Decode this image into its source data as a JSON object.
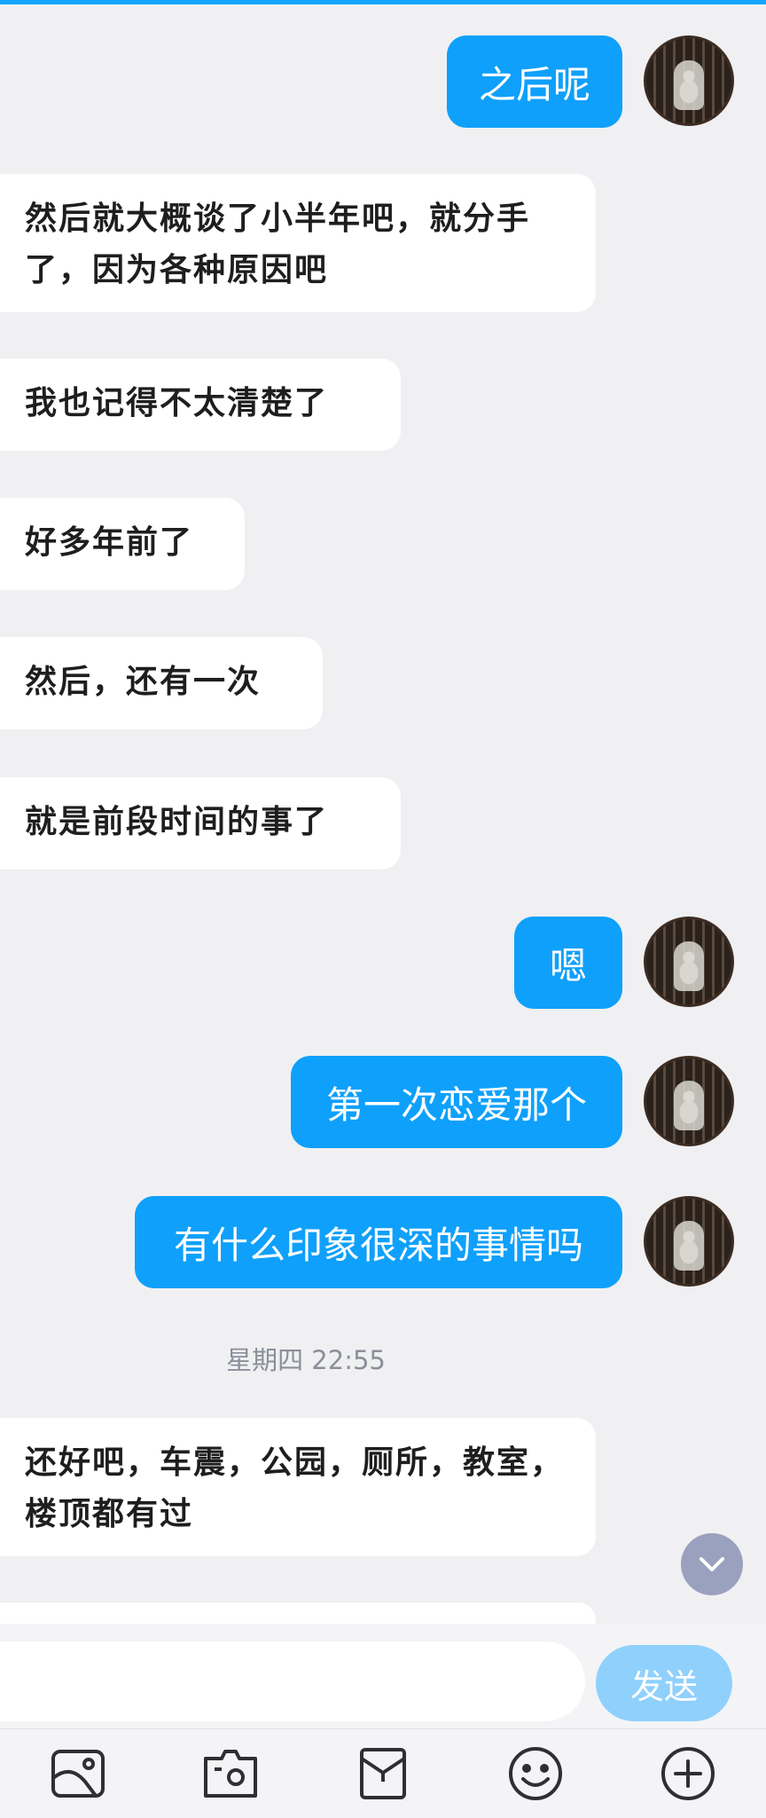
{
  "messages": [
    {
      "side": "right",
      "text": "之后呢"
    },
    {
      "side": "left",
      "text": "然后就大概谈了小半年吧，就分手了，因为各种原因吧"
    },
    {
      "side": "left",
      "text": "我也记得不太清楚了"
    },
    {
      "side": "left",
      "text": "好多年前了"
    },
    {
      "side": "left",
      "text": "然后，还有一次"
    },
    {
      "side": "left",
      "text": "就是前段时间的事了"
    },
    {
      "side": "right",
      "text": "嗯"
    },
    {
      "side": "right",
      "text": "第一次恋爱那个"
    },
    {
      "side": "right",
      "text": "有什么印象很深的事情吗"
    },
    {
      "side": "left",
      "text": "还好吧，车震，公园，厕所，教室，楼顶都有过"
    }
  ],
  "timestamp": "星期四 22:55",
  "input": {
    "placeholder": ""
  },
  "send_label": "发送",
  "toolbar_icons": [
    "image-icon",
    "camera-icon",
    "folder-icon",
    "emoji-icon",
    "plus-icon"
  ],
  "colors": {
    "accent": "#0fa0fb",
    "background": "#f0f0f2",
    "send_disabled": "#8fd0fc"
  }
}
